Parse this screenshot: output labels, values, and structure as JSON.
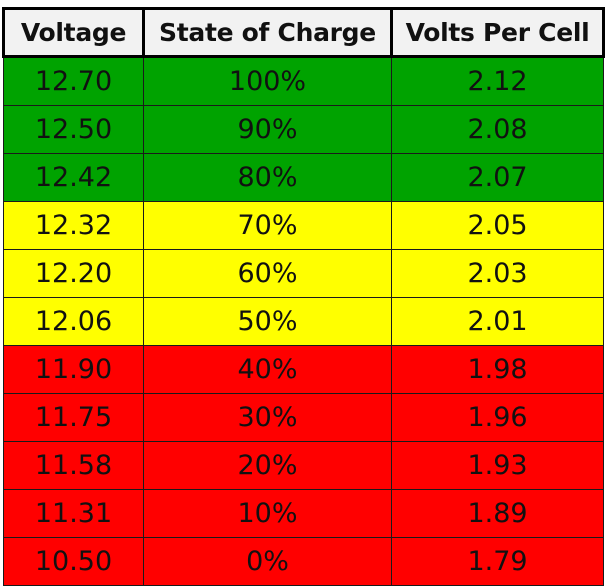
{
  "table": {
    "headers": [
      "Voltage",
      "State of Charge",
      "Volts Per Cell"
    ],
    "status_colors": {
      "good": "#00a300",
      "medium": "#ffff00",
      "low": "#ff0000"
    },
    "rows": [
      {
        "voltage": "12.70",
        "soc": "100%",
        "vpc": "2.12",
        "status": "good"
      },
      {
        "voltage": "12.50",
        "soc": "90%",
        "vpc": "2.08",
        "status": "good"
      },
      {
        "voltage": "12.42",
        "soc": "80%",
        "vpc": "2.07",
        "status": "good"
      },
      {
        "voltage": "12.32",
        "soc": "70%",
        "vpc": "2.05",
        "status": "medium"
      },
      {
        "voltage": "12.20",
        "soc": "60%",
        "vpc": "2.03",
        "status": "medium"
      },
      {
        "voltage": "12.06",
        "soc": "50%",
        "vpc": "2.01",
        "status": "medium"
      },
      {
        "voltage": "11.90",
        "soc": "40%",
        "vpc": "1.98",
        "status": "low"
      },
      {
        "voltage": "11.75",
        "soc": "30%",
        "vpc": "1.96",
        "status": "low"
      },
      {
        "voltage": "11.58",
        "soc": "20%",
        "vpc": "1.93",
        "status": "low"
      },
      {
        "voltage": "11.31",
        "soc": "10%",
        "vpc": "1.89",
        "status": "low"
      },
      {
        "voltage": "10.50",
        "soc": "0%",
        "vpc": "1.79",
        "status": "low"
      }
    ]
  }
}
